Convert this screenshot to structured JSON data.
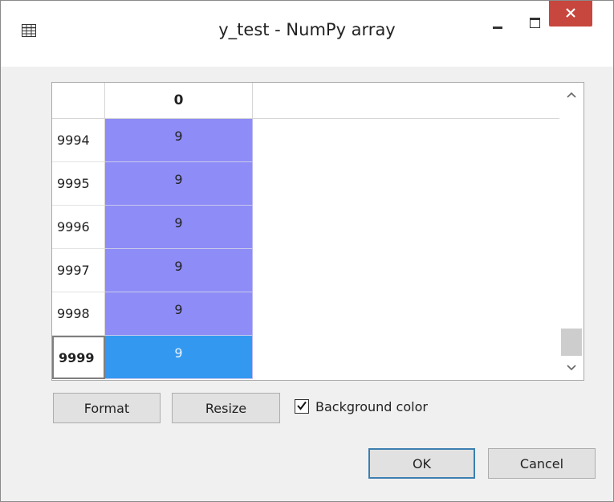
{
  "window": {
    "title": "y_test - NumPy array"
  },
  "grid": {
    "column_header": "0",
    "rows": [
      {
        "index": "9994",
        "value": "9"
      },
      {
        "index": "9995",
        "value": "9"
      },
      {
        "index": "9996",
        "value": "9"
      },
      {
        "index": "9997",
        "value": "9"
      },
      {
        "index": "9998",
        "value": "9"
      },
      {
        "index": "9999",
        "value": "9"
      }
    ],
    "selected_row": "9999",
    "cell_color": "#8e8cf6",
    "selected_color": "#3399f0"
  },
  "controls": {
    "format_label": "Format",
    "resize_label": "Resize",
    "background_color_label": "Background color",
    "background_color_checked": true,
    "ok_label": "OK",
    "cancel_label": "Cancel"
  },
  "icons": {
    "app": "table-icon",
    "minimize": "minimize-icon",
    "maximize": "maximize-icon",
    "close": "close-icon",
    "scroll_up": "chevron-up-icon",
    "scroll_down": "chevron-down-icon",
    "check": "check-icon"
  },
  "colors": {
    "close_button": "#c7463d"
  }
}
